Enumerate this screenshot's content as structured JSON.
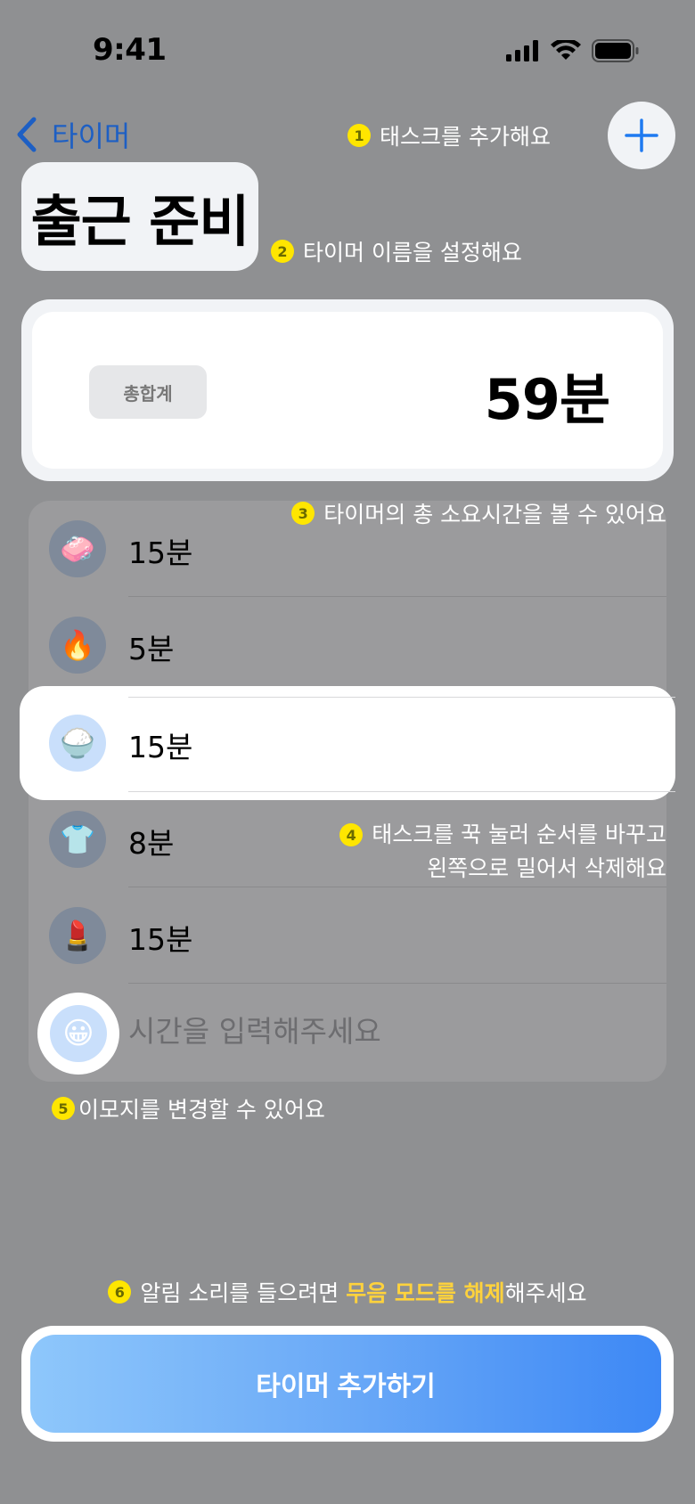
{
  "status_bar": {
    "time": "9:41"
  },
  "nav": {
    "back_label": "타이머"
  },
  "title": "출근 준비",
  "tips": {
    "t1": {
      "num": "1",
      "text": "태스크를 추가해요"
    },
    "t2": {
      "num": "2",
      "text": "타이머 이름을 설정해요"
    },
    "t3": {
      "num": "3",
      "text": "타이머의 총 소요시간을 볼 수 있어요"
    },
    "t4": {
      "num": "4",
      "line1": "태스크를 꾹 눌러 순서를 바꾸고",
      "line2": "왼쪽으로 밀어서 삭제해요"
    },
    "t5": {
      "num": "5",
      "text": "이모지를 변경할 수 있어요"
    },
    "t6": {
      "num": "6",
      "before": "알림 소리를 들으려면 ",
      "highlight": "무음 모드를 해제",
      "after": "해주세요"
    }
  },
  "total": {
    "label": "총합계",
    "value": "59분"
  },
  "tasks": [
    {
      "emoji": "🧼",
      "icon": "soap-icon",
      "duration": "15분"
    },
    {
      "emoji": "🔥",
      "icon": "fire-icon",
      "duration": "5분"
    },
    {
      "emoji": "🍚",
      "icon": "rice-bowl-icon",
      "duration": "15분"
    },
    {
      "emoji": "👕",
      "icon": "shirt-icon",
      "duration": "8분"
    },
    {
      "emoji": "💄",
      "icon": "lipstick-icon",
      "duration": "15분"
    }
  ],
  "new_task": {
    "emoji": "😀",
    "placeholder": "시간을 입력해주세요"
  },
  "cta_label": "타이머 추가하기",
  "colors": {
    "accent": "#1d5fc4",
    "tip_badge": "#ffe600",
    "highlight": "#ffd23c"
  }
}
